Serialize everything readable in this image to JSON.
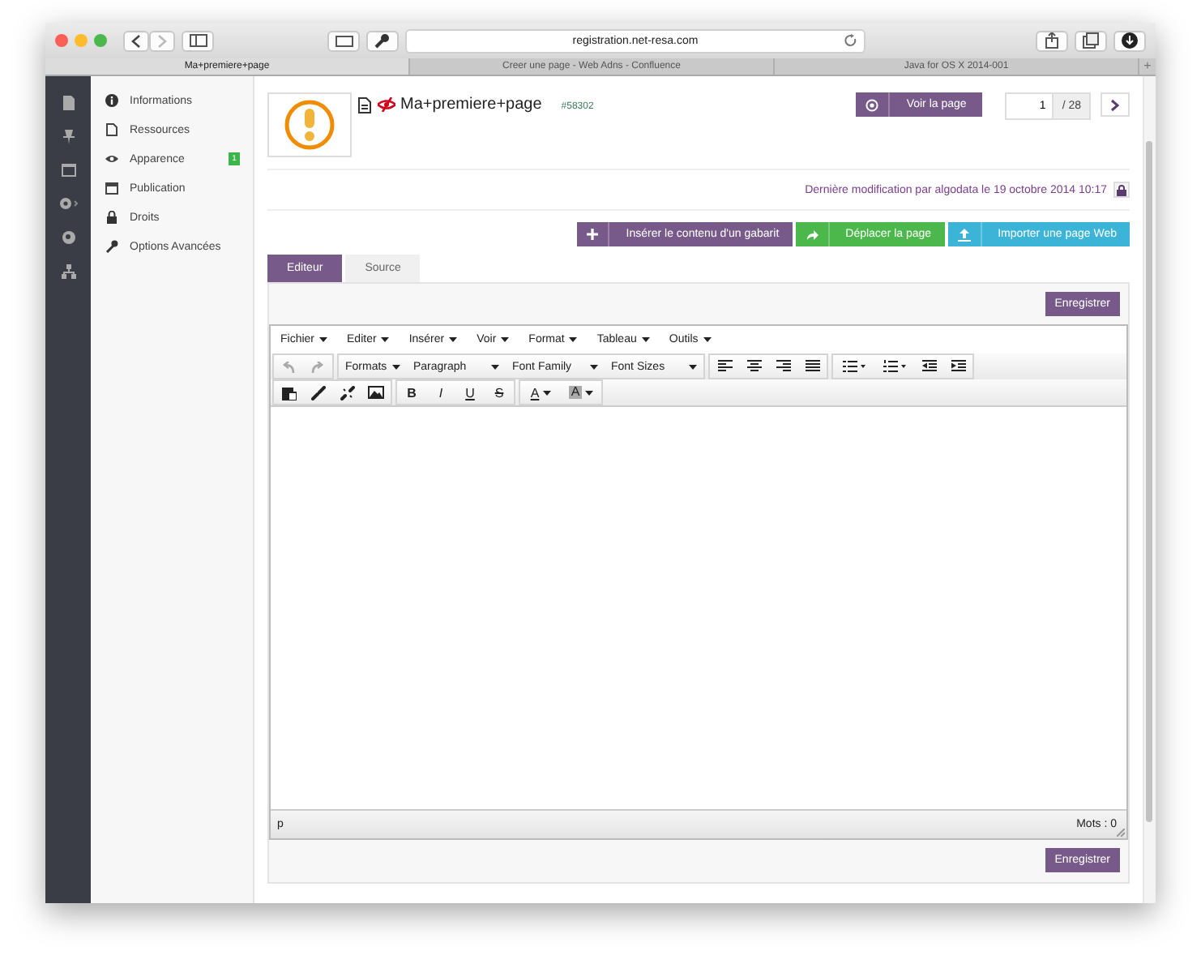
{
  "browser": {
    "address": "registration.net-resa.com",
    "tabs": [
      {
        "label": "Ma+premiere+page",
        "selected": true
      },
      {
        "label": "Creer une page - Web Adns - Confluence",
        "selected": false
      },
      {
        "label": "Java for OS X 2014-001",
        "selected": false
      }
    ],
    "new_tab": "+"
  },
  "nav": {
    "items": [
      {
        "label": "Informations"
      },
      {
        "label": "Ressources"
      },
      {
        "label": "Apparence",
        "badge": "1"
      },
      {
        "label": "Publication"
      },
      {
        "label": "Droits"
      },
      {
        "label": "Options Avancées"
      }
    ]
  },
  "page": {
    "title": "Ma+premiere+page",
    "id": "#58302",
    "view_button": "Voir la page",
    "pager": {
      "current": "1",
      "total": "/ 28"
    },
    "modified": "Dernière modification par algodata le 19 octobre 2014 10:17",
    "actions": [
      {
        "label": "Insérer le contenu d'un gabarit",
        "kind": "template"
      },
      {
        "label": "Déplacer la page",
        "kind": "move"
      },
      {
        "label": "Importer une page Web",
        "kind": "import"
      }
    ]
  },
  "editor": {
    "tabs": [
      {
        "label": "Editeur",
        "selected": true
      },
      {
        "label": "Source",
        "selected": false
      }
    ],
    "save_top": "Enregistrer",
    "menu": [
      "Fichier",
      "Editer",
      "Insérer",
      "Voir",
      "Format",
      "Tableau",
      "Outils"
    ],
    "dropdowns": [
      {
        "label": "Formats",
        "kind": "short"
      },
      {
        "label": "Paragraph",
        "kind": "wide"
      },
      {
        "label": "Font Family",
        "kind": "wide"
      },
      {
        "label": "Font Sizes",
        "kind": "wide"
      }
    ],
    "bold": "B",
    "italic": "I",
    "underline": "U",
    "strike": "S",
    "text_color": "A",
    "back_color": "A",
    "path": "p",
    "word_count": "Mots : 0",
    "save_bottom": "Enregistrer"
  }
}
